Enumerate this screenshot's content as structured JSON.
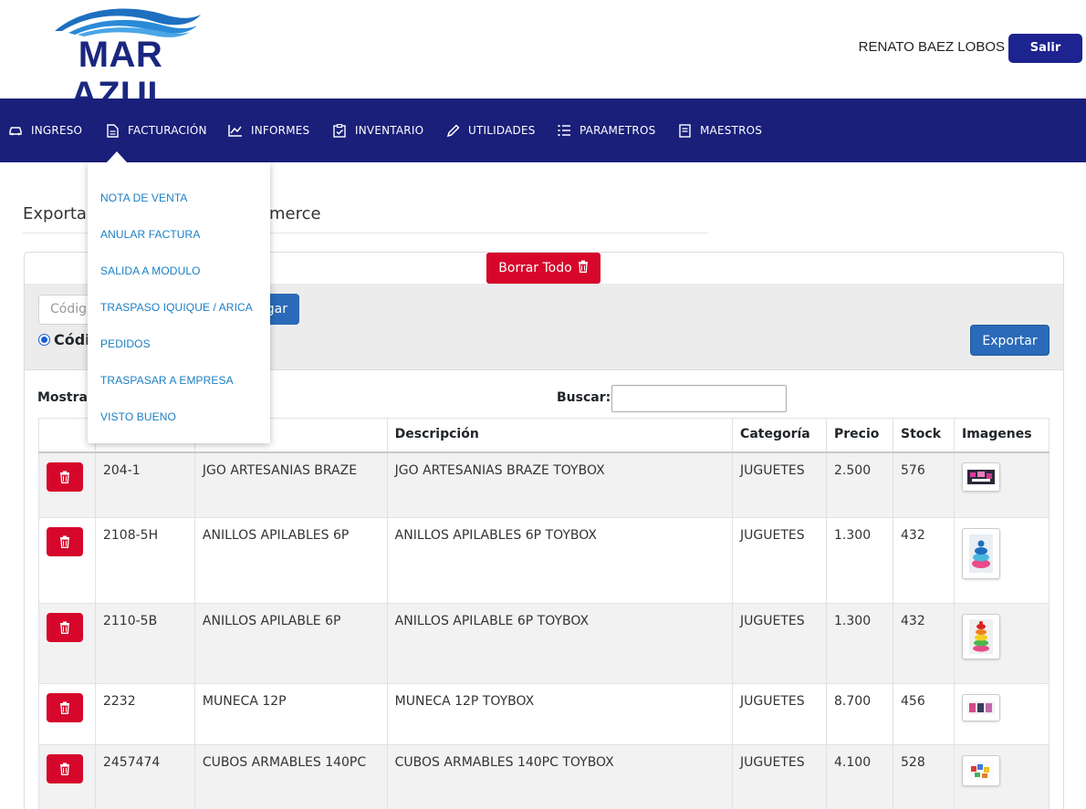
{
  "header": {
    "logo_text": "MAR AZUL",
    "user_name": "RENATO BAEZ LOBOS",
    "logout_label": "Salir"
  },
  "nav": {
    "items": [
      {
        "label": "INGRESO",
        "icon": "car-icon"
      },
      {
        "label": "FACTURACIÓN",
        "icon": "document-icon"
      },
      {
        "label": "INFORMES",
        "icon": "chart-line-icon"
      },
      {
        "label": "INVENTARIO",
        "icon": "clipboard-check-icon"
      },
      {
        "label": "UTILIDADES",
        "icon": "pencil-icon"
      },
      {
        "label": "PARAMETROS",
        "icon": "list-ordered-icon"
      },
      {
        "label": "MAESTROS",
        "icon": "book-icon"
      }
    ]
  },
  "dropdown": {
    "items": [
      "NOTA DE VENTA",
      "ANULAR FACTURA",
      "SALIDA A MODULO",
      "TRASPASO IQUIQUE / ARICA",
      "PEDIDOS",
      "TRASPASAR A EMPRESA",
      "VISTO BUENO"
    ]
  },
  "page": {
    "title_left": "Exporta",
    "title_right": "merce"
  },
  "toolbar": {
    "delete_all_label": "Borrar Todo",
    "code_placeholder": "Códig",
    "load_label": "gar",
    "radio_label": "Códi",
    "export_label": "Exportar",
    "show_label": "Mostra",
    "search_label": "Buscar:"
  },
  "table": {
    "columns": [
      "",
      "",
      "",
      "Descripción",
      "Categoría",
      "Precio",
      "Stock",
      "Imagenes"
    ],
    "rows": [
      {
        "code": "204-1",
        "name": "JGO ARTESANIAS BRAZE",
        "description": "JGO ARTESANIAS BRAZE TOYBOX",
        "category": "JUGUETES",
        "price": "2.500",
        "stock": "576"
      },
      {
        "code": "2108-5H",
        "name": "ANILLOS APILABLES 6P",
        "description": "ANILLOS APILABLES 6P TOYBOX",
        "category": "JUGUETES",
        "price": "1.300",
        "stock": "432"
      },
      {
        "code": "2110-5B",
        "name": "ANILLOS APILABLE 6P",
        "description": "ANILLOS APILABLE 6P TOYBOX",
        "category": "JUGUETES",
        "price": "1.300",
        "stock": "432"
      },
      {
        "code": "2232",
        "name": "MUNECA 12P",
        "description": "MUNECA 12P TOYBOX",
        "category": "JUGUETES",
        "price": "8.700",
        "stock": "456"
      },
      {
        "code": "2457474",
        "name": "CUBOS ARMABLES 140PC",
        "description": "CUBOS ARMABLES 140PC TOYBOX",
        "category": "JUGUETES",
        "price": "4.100",
        "stock": "528"
      }
    ]
  },
  "colors": {
    "navbar": "#1a1f7a",
    "logout": "#1d238f",
    "danger": "#d6072b",
    "primary": "#2a6ab8",
    "link": "#1a7fc4"
  }
}
